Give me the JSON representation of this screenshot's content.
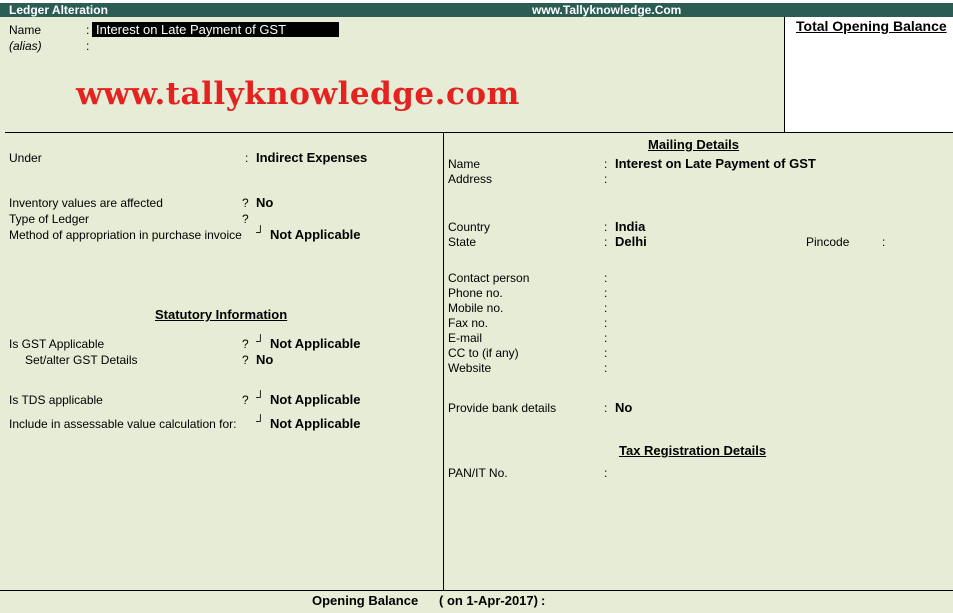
{
  "window": {
    "title": "Ledger Alteration",
    "site": "www.Tallyknowledge.Com"
  },
  "header": {
    "name_label": "Name",
    "name_colon": ":",
    "name_value": "Interest on Late Payment of GST",
    "alias_label": "(alias)",
    "alias_colon": ":",
    "watermark": "www.tallyknowledge.com",
    "total_opening_balance_label": "Total Opening Balance"
  },
  "left": {
    "under_label": "Under",
    "under_colon": ":",
    "under_value": "Indirect Expenses",
    "inventory_label": "Inventory values are affected",
    "inventory_sep": "?",
    "inventory_value": "No",
    "type_label": "Type of Ledger",
    "type_sep": "?",
    "method_label": "Method of appropriation in purchase invoice",
    "method_sep": "┘",
    "method_value": "Not Applicable",
    "statutory_title": "Statutory Information",
    "gst_label": "Is GST Applicable",
    "gst_sep": "?",
    "gst_marker": "┘",
    "gst_value": "Not Applicable",
    "setalter_label": "Set/alter GST Details",
    "setalter_sep": "?",
    "setalter_value": "No",
    "tds_label": "Is TDS applicable",
    "tds_sep": "?",
    "tds_marker": "┘",
    "tds_value": "Not Applicable",
    "assess_label": "Include in assessable value calculation for:",
    "assess_marker": "┘",
    "assess_value": "Not Applicable"
  },
  "right": {
    "mailing_title": "Mailing Details",
    "name_label": "Name",
    "name_colon": ":",
    "name_value": "Interest on Late Payment of GST",
    "address_label": "Address",
    "address_colon": ":",
    "country_label": "Country",
    "country_colon": ":",
    "country_value": "India",
    "state_label": "State",
    "state_colon": ":",
    "state_value": "Delhi",
    "pincode_label": "Pincode",
    "pincode_colon": ":",
    "contact_label": "Contact person",
    "phone_label": "Phone no.",
    "mobile_label": "Mobile no.",
    "fax_label": "Fax no.",
    "email_label": "E-mail",
    "cc_label": "CC to (if any)",
    "website_label": "Website",
    "colon": ":",
    "bank_label": "Provide bank details",
    "bank_colon": ":",
    "bank_value": "No",
    "tax_title": "Tax Registration Details",
    "pan_label": "PAN/IT No.",
    "pan_colon": ":"
  },
  "footer": {
    "opening_balance_label": "Opening Balance",
    "opening_balance_date": "( on 1-Apr-2017)",
    "opening_balance_colon": ":"
  }
}
